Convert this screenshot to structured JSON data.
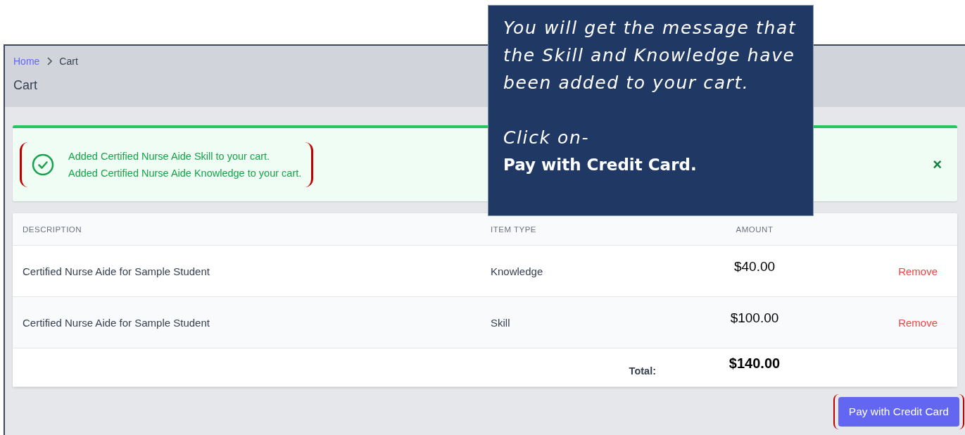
{
  "breadcrumb": [
    {
      "label": "Home",
      "kind": "link"
    },
    {
      "label": "Cart",
      "kind": "current"
    }
  ],
  "page_title": "Cart",
  "alert": {
    "messages": [
      "Added Certified Nurse Aide Skill to your cart.",
      "Added Certified Nurse Aide Knowledge to your cart."
    ],
    "close": "×",
    "highlighted": true
  },
  "table": {
    "columns": [
      "DESCRIPTION",
      "ITEM TYPE",
      "AMOUNT"
    ],
    "rows": [
      {
        "description": "Certified Nurse Aide for Sample Student",
        "item_type": "Knowledge",
        "amount": "$40.00",
        "action": "Remove"
      },
      {
        "description": "Certified Nurse Aide for Sample Student",
        "item_type": "Skill",
        "amount": "$100.00",
        "action": "Remove"
      }
    ],
    "total_label": "Total:",
    "total": "$140.00"
  },
  "pay_button": {
    "label": "Pay with Credit Card",
    "highlighted": true
  },
  "callout": {
    "message": "You will get the message that the Skill and Knowledge have been added to your cart.",
    "instruction": "Click on-",
    "action": "Pay with Credit Card."
  }
}
